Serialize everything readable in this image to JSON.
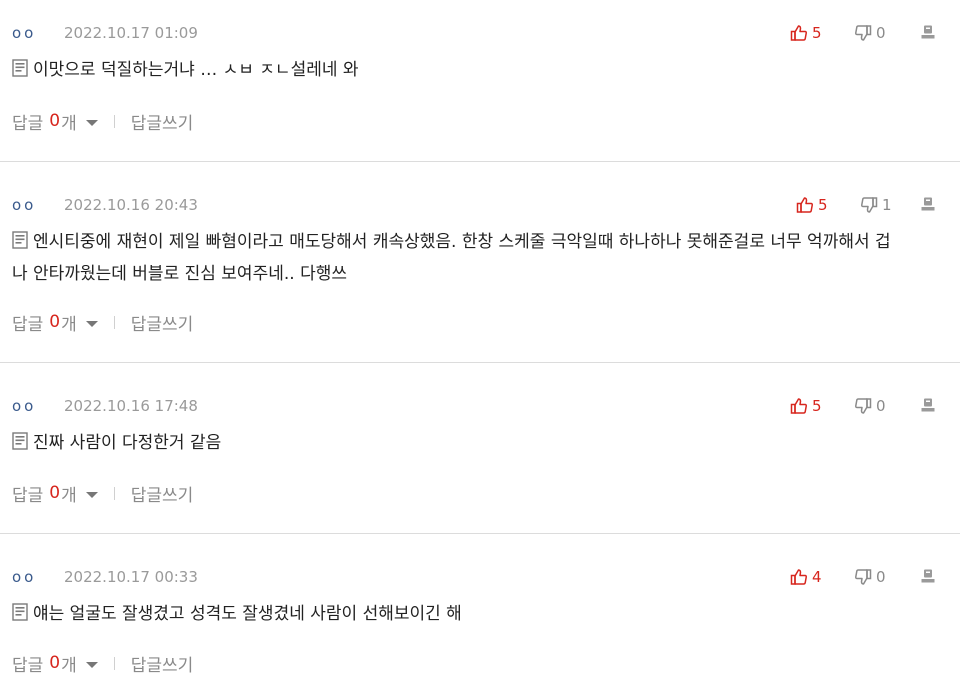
{
  "comments": [
    {
      "nickname": "oo",
      "date": "2022.10.17 01:09",
      "likes": "5",
      "dislikes": "0",
      "lines": [
        "이맛으로 덕질하는거냐 … ㅅㅂ ㅈㄴ설레네 와"
      ],
      "reply_label": "답글",
      "reply_count": "0",
      "reply_unit": "개",
      "write_reply": "답글쓰기"
    },
    {
      "nickname": "oo",
      "date": "2022.10.16 20:43",
      "likes": "5",
      "dislikes": "1",
      "lines": [
        "엔시티중에 재현이 제일 빠혐이라고 매도당해서 캐속상했음. 한창 스케줄 극악일때 하나하나 못해준걸로 너무 억까해서 겁",
        "나 안타까웠는데 버블로 진심 보여주네.. 다행쓰"
      ],
      "reply_label": "답글",
      "reply_count": "0",
      "reply_unit": "개",
      "write_reply": "답글쓰기"
    },
    {
      "nickname": "oo",
      "date": "2022.10.16 17:48",
      "likes": "5",
      "dislikes": "0",
      "lines": [
        "진짜 사람이 다정한거 같음"
      ],
      "reply_label": "답글",
      "reply_count": "0",
      "reply_unit": "개",
      "write_reply": "답글쓰기"
    },
    {
      "nickname": "oo",
      "date": "2022.10.17 00:33",
      "likes": "4",
      "dislikes": "0",
      "lines": [
        "얘는 얼굴도 잘생겼고 성격도 잘생겼네 사람이 선해보이긴 해"
      ],
      "reply_label": "답글",
      "reply_count": "0",
      "reply_unit": "개",
      "write_reply": "답글쓰기"
    }
  ],
  "icons": {
    "like": "thumbs-up-icon",
    "dislike": "thumbs-down-icon",
    "report": "report-icon",
    "memo": "memo-icon",
    "expand": "chevron-down-icon"
  },
  "colors": {
    "accent_red": "#d7261e",
    "nickname_blue": "#3a5a8c",
    "muted": "#8a8a8a",
    "text": "#222222",
    "divider": "#dcdcdc"
  }
}
